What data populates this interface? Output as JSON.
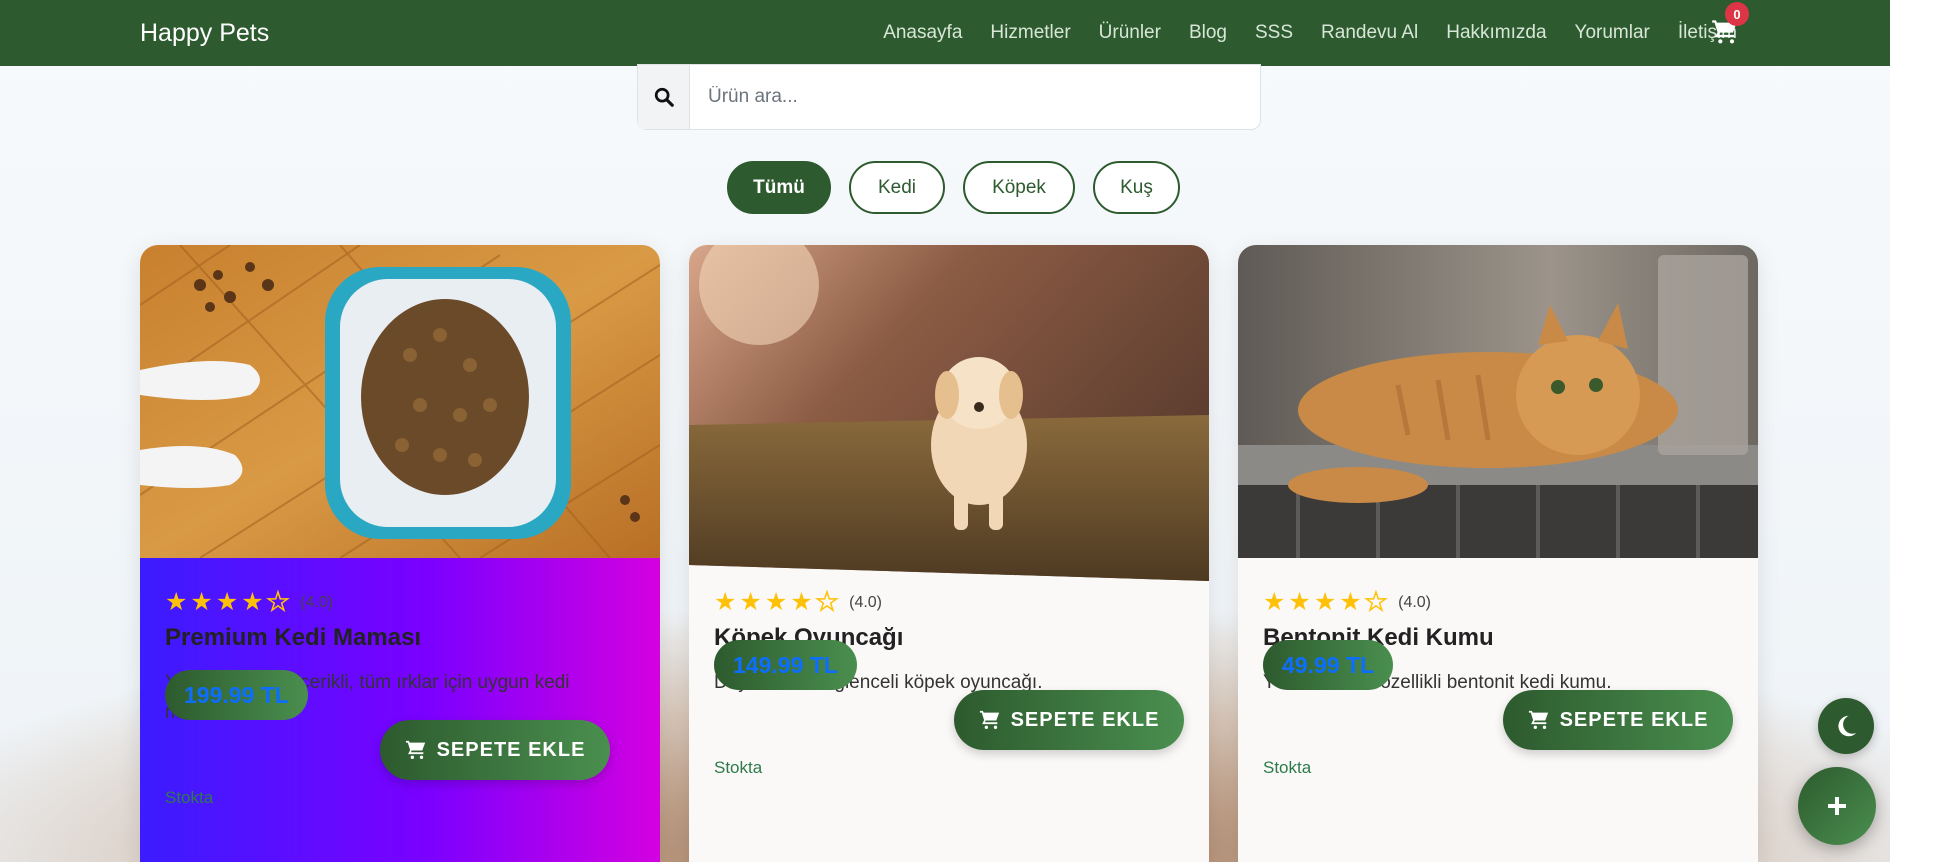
{
  "navbar": {
    "brand": "Happy Pets",
    "links": [
      "Anasayfa",
      "Hizmetler",
      "Ürünler",
      "Blog",
      "SSS",
      "Randevu Al",
      "Hakkımızda",
      "Yorumlar",
      "İletişim"
    ],
    "cart_count": "0"
  },
  "search": {
    "placeholder": "Ürün ara..."
  },
  "filters": {
    "all": "Tümü",
    "cat": "Kedi",
    "dog": "Köpek",
    "bird": "Kuş",
    "active": "Tümü"
  },
  "products": [
    {
      "rating_text": "(4.0)",
      "rating": 4,
      "title": "Premium Kedi Maması",
      "description": "Yüksek protein içerikli, tüm ırklar için uygun kedi maması.",
      "price": "199.99 TL",
      "button": "SEPETE EKLE",
      "stock": "Stokta"
    },
    {
      "rating_text": "(4.0)",
      "rating": 4,
      "title": "Köpek Oyuncağı",
      "description": "Dayanıklı ve eğlenceli köpek oyuncağı.",
      "price": "149.99 TL",
      "button": "SEPETE EKLE",
      "stock": "Stokta"
    },
    {
      "rating_text": "(4.0)",
      "rating": 4,
      "title": "Bentonit Kedi Kumu",
      "description": "Yüksek emici özellikli bentonit kedi kumu.",
      "price": "49.99 TL",
      "button": "SEPETE EKLE",
      "stock": "Stokta"
    }
  ],
  "colors": {
    "primary": "#2d5a2e",
    "accent": "#4a8f4f",
    "star": "#ffc107",
    "badge": "#dc3545",
    "price_text": "#0d6efd"
  },
  "icons": {
    "search": "search-icon",
    "cart": "cart-icon",
    "theme": "moon-icon",
    "add": "plus-icon"
  }
}
